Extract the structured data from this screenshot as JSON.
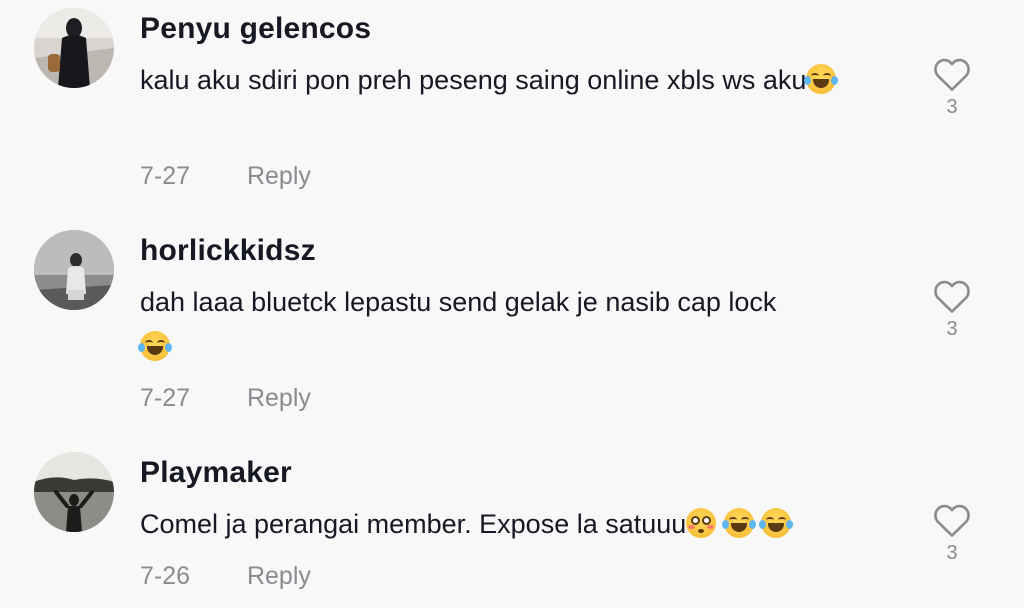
{
  "comments": [
    {
      "username": "Penyu gelencos",
      "text": "kalu aku sdiri pon preh peseng saing online xbls ws aku",
      "emojis": [
        "face-with-tears-of-joy"
      ],
      "date": "7-27",
      "reply_label": "Reply",
      "like_count": "3",
      "like_icon": "heart-outline-icon"
    },
    {
      "username": "horlickkidsz",
      "text": "dah laaa bluetck lepastu send gelak je nasib cap lock",
      "emojis": [
        "face-with-tears-of-joy"
      ],
      "date": "7-27",
      "reply_label": "Reply",
      "like_count": "3",
      "like_icon": "heart-outline-icon"
    },
    {
      "username": "Playmaker",
      "text": "Comel ja perangai member. Expose la satuuu",
      "emojis": [
        "flushed-face",
        "face-with-tears-of-joy",
        "face-with-tears-of-joy"
      ],
      "date": "7-26",
      "reply_label": "Reply",
      "like_count": "3",
      "like_icon": "heart-outline-icon"
    }
  ],
  "colors": {
    "background": "#f8f8f8",
    "username": "#161823",
    "text": "#161823",
    "meta": "#8a8b91"
  }
}
